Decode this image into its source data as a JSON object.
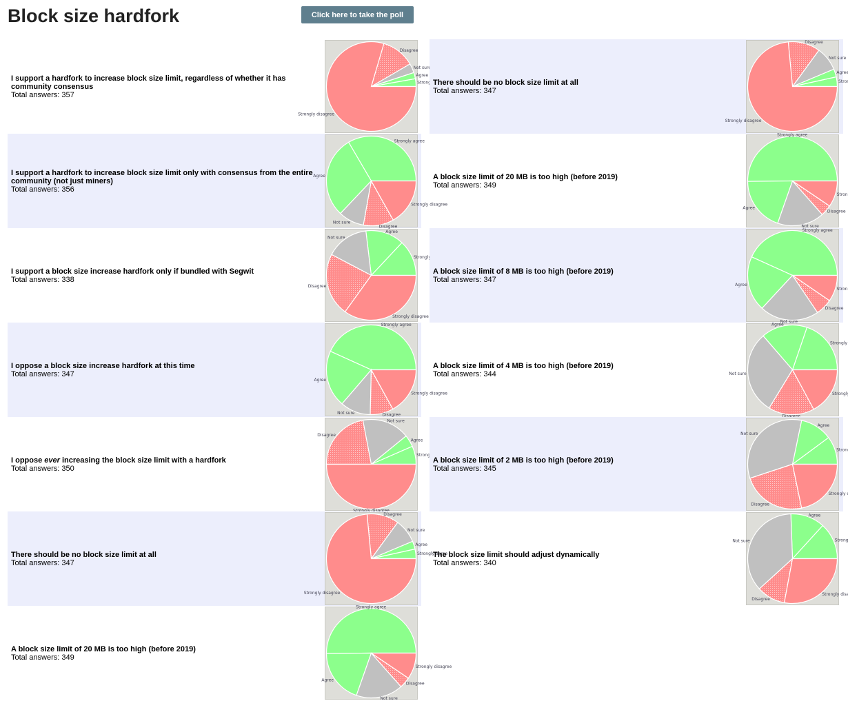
{
  "header": {
    "title": "Block size hardfork",
    "poll_button_label": "Click here to take the poll"
  },
  "total_prefix": "Total answers: ",
  "colors": {
    "Strongly agree": "#8cff8c",
    "Agree": "#8cff8c",
    "Not sure": "#c0c0c0",
    "Disagree": "#ff8c8c",
    "Strongly disagree": "#ff8c8c",
    "button": "#5f7f8e",
    "shaded_row": "#eceefc"
  },
  "left_questions": [
    {
      "pre": "I support a hardfork to increase block size limit, regardless of whether it has community consensus",
      "em": "",
      "post": "",
      "total": "357",
      "shaded": false,
      "chart_data": {
        "type": "pie",
        "slices": [
          {
            "label": "Strongly agree",
            "value": 10
          },
          {
            "label": "Agree",
            "value": 8
          },
          {
            "label": "Not sure",
            "value": 12
          },
          {
            "label": "Disagree",
            "value": 43
          },
          {
            "label": "Strongly disagree",
            "value": 284
          }
        ]
      }
    },
    {
      "pre": "I support a hardfork to increase block size limit only with consensus from the entire community (not just miners)",
      "em": "",
      "post": "",
      "total": "356",
      "shaded": true,
      "chart_data": {
        "type": "pie",
        "slices": [
          {
            "label": "Strongly agree",
            "value": 119
          },
          {
            "label": "Agree",
            "value": 105
          },
          {
            "label": "Not sure",
            "value": 33
          },
          {
            "label": "Disagree",
            "value": 39
          },
          {
            "label": "Strongly disagree",
            "value": 60
          }
        ]
      }
    },
    {
      "pre": "I support a block size increase hardfork only if bundled with Segwit",
      "em": "",
      "post": "",
      "total": "338",
      "shaded": false,
      "chart_data": {
        "type": "pie",
        "slices": [
          {
            "label": "Strongly agree",
            "value": 44
          },
          {
            "label": "Agree",
            "value": 47
          },
          {
            "label": "Not sure",
            "value": 52
          },
          {
            "label": "Disagree",
            "value": 77
          },
          {
            "label": "Strongly disagree",
            "value": 118
          }
        ]
      }
    },
    {
      "pre": "I oppose a block size increase hardfork at this time",
      "em": "",
      "post": "",
      "total": "347",
      "shaded": true,
      "chart_data": {
        "type": "pie",
        "slices": [
          {
            "label": "Strongly agree",
            "value": 150
          },
          {
            "label": "Agree",
            "value": 71
          },
          {
            "label": "Not sure",
            "value": 38
          },
          {
            "label": "Disagree",
            "value": 29
          },
          {
            "label": "Strongly disagree",
            "value": 59
          }
        ]
      }
    },
    {
      "pre": "I oppose ",
      "em": "ever",
      "post": " increasing the block size limit with a hardfork",
      "total": "350",
      "shaded": false,
      "chart_data": {
        "type": "pie",
        "slices": [
          {
            "label": "Strongly agree",
            "value": 23
          },
          {
            "label": "Agree",
            "value": 15
          },
          {
            "label": "Not sure",
            "value": 60
          },
          {
            "label": "Disagree",
            "value": 77
          },
          {
            "label": "Strongly disagree",
            "value": 175
          }
        ]
      }
    },
    {
      "pre": "There should be no block size limit at all",
      "em": "",
      "post": "",
      "total": "347",
      "shaded": true,
      "chart_data": {
        "type": "pie",
        "slices": [
          {
            "label": "Strongly agree",
            "value": 12
          },
          {
            "label": "Agree",
            "value": 10
          },
          {
            "label": "Not sure",
            "value": 30
          },
          {
            "label": "Disagree",
            "value": 40
          },
          {
            "label": "Strongly disagree",
            "value": 255
          }
        ]
      }
    },
    {
      "pre": "A block size limit of 20 MB is too high (before 2019)",
      "em": "",
      "post": "",
      "total": "349",
      "shaded": false,
      "chart_data": {
        "type": "pie",
        "slices": [
          {
            "label": "Strongly agree",
            "value": 175
          },
          {
            "label": "Agree",
            "value": 68
          },
          {
            "label": "Not sure",
            "value": 59
          },
          {
            "label": "Disagree",
            "value": 14
          },
          {
            "label": "Strongly disagree",
            "value": 33
          }
        ]
      }
    }
  ],
  "right_questions": [
    {
      "pre": "There should be no block size limit at all",
      "em": "",
      "post": "",
      "total": "347",
      "shaded": true,
      "chart_data": {
        "type": "pie",
        "slices": [
          {
            "label": "Strongly agree",
            "value": 12
          },
          {
            "label": "Agree",
            "value": 10
          },
          {
            "label": "Not sure",
            "value": 30
          },
          {
            "label": "Disagree",
            "value": 40
          },
          {
            "label": "Strongly disagree",
            "value": 255
          }
        ]
      }
    },
    {
      "pre": "A block size limit of 20 MB is too high (before 2019)",
      "em": "",
      "post": "",
      "total": "349",
      "shaded": false,
      "chart_data": {
        "type": "pie",
        "slices": [
          {
            "label": "Strongly agree",
            "value": 175
          },
          {
            "label": "Agree",
            "value": 68
          },
          {
            "label": "Not sure",
            "value": 59
          },
          {
            "label": "Disagree",
            "value": 14
          },
          {
            "label": "Strongly disagree",
            "value": 33
          }
        ]
      }
    },
    {
      "pre": "A block size limit of 8 MB is too high (before 2019)",
      "em": "",
      "post": "",
      "total": "347",
      "shaded": true,
      "chart_data": {
        "type": "pie",
        "slices": [
          {
            "label": "Strongly agree",
            "value": 150
          },
          {
            "label": "Agree",
            "value": 69
          },
          {
            "label": "Not sure",
            "value": 74
          },
          {
            "label": "Disagree",
            "value": 21
          },
          {
            "label": "Strongly disagree",
            "value": 33
          }
        ]
      }
    },
    {
      "pre": "A block size limit of 4 MB is too high (before 2019)",
      "em": "",
      "post": "",
      "total": "344",
      "shaded": false,
      "chart_data": {
        "type": "pie",
        "slices": [
          {
            "label": "Strongly agree",
            "value": 68
          },
          {
            "label": "Agree",
            "value": 57
          },
          {
            "label": "Not sure",
            "value": 103
          },
          {
            "label": "Disagree",
            "value": 57
          },
          {
            "label": "Strongly disagree",
            "value": 59
          }
        ]
      }
    },
    {
      "pre": "A block size limit of 2 MB is too high (before 2019)",
      "em": "",
      "post": "",
      "total": "345",
      "shaded": true,
      "chart_data": {
        "type": "pie",
        "slices": [
          {
            "label": "Strongly agree",
            "value": 35
          },
          {
            "label": "Agree",
            "value": 40
          },
          {
            "label": "Not sure",
            "value": 115
          },
          {
            "label": "Disagree",
            "value": 80
          },
          {
            "label": "Strongly disagree",
            "value": 75
          }
        ]
      }
    },
    {
      "pre": "The block size limit should adjust dynamically",
      "em": "",
      "post": "",
      "total": "340",
      "shaded": false,
      "chart_data": {
        "type": "pie",
        "slices": [
          {
            "label": "Strongly agree",
            "value": 45
          },
          {
            "label": "Agree",
            "value": 42
          },
          {
            "label": "Not sure",
            "value": 123
          },
          {
            "label": "Disagree",
            "value": 35
          },
          {
            "label": "Strongly disagree",
            "value": 95
          }
        ]
      }
    }
  ]
}
